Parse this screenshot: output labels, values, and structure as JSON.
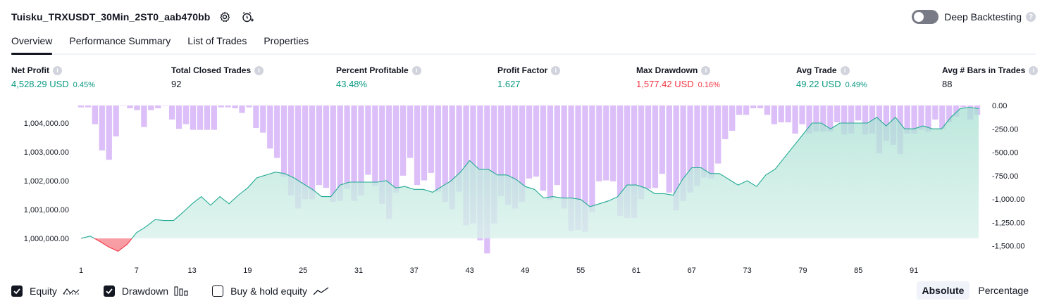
{
  "header": {
    "strategy_title": "Tuisku_TRXUSDT_30Min_2ST0_aab470bb",
    "settings_icon": "gear-icon",
    "alert_icon": "alarm-clock-plus-icon",
    "deep_backtesting_label": "Deep Backtesting",
    "deep_backtesting_enabled": false,
    "help": "?"
  },
  "tabs": [
    {
      "label": "Overview",
      "active": true
    },
    {
      "label": "Performance Summary",
      "active": false
    },
    {
      "label": "List of Trades",
      "active": false
    },
    {
      "label": "Properties",
      "active": false
    }
  ],
  "metrics": [
    {
      "label": "Net Profit",
      "value": "4,528.29 USD",
      "pct": "0.45%",
      "color": "pos"
    },
    {
      "label": "Total Closed Trades",
      "value": "92",
      "pct": "",
      "color": "neutral"
    },
    {
      "label": "Percent Profitable",
      "value": "43.48%",
      "pct": "",
      "color": "pos"
    },
    {
      "label": "Profit Factor",
      "value": "1.627",
      "pct": "",
      "color": "pos"
    },
    {
      "label": "Max Drawdown",
      "value": "1,577.42 USD",
      "pct": "0.16%",
      "color": "neg"
    },
    {
      "label": "Avg Trade",
      "value": "49.22 USD",
      "pct": "0.49%",
      "color": "pos"
    },
    {
      "label": "Avg # Bars in Trades",
      "value": "88",
      "pct": "",
      "color": "neutral"
    }
  ],
  "chart_data": {
    "type": "area",
    "equity_y_ticks": [
      "1,000,000.00",
      "1,001,000.00",
      "1,002,000.00",
      "1,003,000.00",
      "1,004,000.00"
    ],
    "drawdown_y_ticks": [
      "0.00",
      "-250.00",
      "-500.00",
      "-750.00",
      "-1,000.00",
      "-1,250.00",
      "-1,500.00"
    ],
    "x_ticks": [
      "1",
      "7",
      "13",
      "19",
      "25",
      "31",
      "37",
      "43",
      "49",
      "55",
      "61",
      "67",
      "73",
      "79",
      "85",
      "91"
    ],
    "equity_baseline": 1000000,
    "equity_ylim": [
      999550,
      1004900
    ],
    "drawdown_ylim": [
      -1577,
      0
    ],
    "series": [
      {
        "name": "Equity",
        "type": "area",
        "values": [
          1000000,
          1000080,
          999900,
          999700,
          999550,
          999800,
          1000200,
          1000400,
          1000650,
          1000620,
          1000620,
          1000900,
          1001200,
          1001450,
          1001150,
          1001450,
          1001200,
          1001500,
          1001750,
          1002100,
          1002200,
          1002300,
          1002250,
          1002100,
          1001900,
          1001700,
          1001450,
          1001450,
          1001850,
          1001950,
          1001950,
          1001950,
          1001950,
          1002000,
          1001750,
          1001800,
          1001700,
          1001700,
          1001600,
          1001800,
          1002000,
          1002300,
          1002700,
          1002400,
          1002400,
          1002200,
          1002200,
          1002050,
          1001800,
          1001700,
          1001400,
          1001450,
          1001400,
          1001400,
          1001350,
          1001100,
          1001200,
          1001300,
          1001450,
          1001850,
          1001850,
          1001750,
          1001550,
          1001550,
          1001500,
          1002050,
          1002450,
          1002450,
          1002250,
          1002250,
          1002050,
          1001850,
          1002000,
          1001800,
          1002200,
          1002400,
          1002800,
          1003200,
          1003600,
          1004000,
          1004000,
          1003800,
          1004000,
          1004000,
          1004000,
          1004000,
          1004200,
          1003900,
          1004200,
          1003800,
          1003800,
          1003900,
          1003800,
          1003800,
          1004200,
          1004500,
          1004550,
          1004500
        ]
      },
      {
        "name": "Drawdown",
        "type": "bar",
        "values": [
          -20,
          -20,
          -200,
          -480,
          -580,
          -330,
          0,
          -30,
          -50,
          -230,
          -50,
          -30,
          0,
          -150,
          -250,
          -200,
          -260,
          -260,
          -260,
          -260,
          -20,
          -20,
          -30,
          -80,
          -20,
          -240,
          -290,
          -460,
          -560,
          -760,
          -960,
          -1100,
          -1000,
          -1000,
          -850,
          -880,
          -1030,
          -1020,
          -890,
          -1020,
          -960,
          -740,
          -860,
          -1050,
          -1210,
          -930,
          -750,
          -560,
          -850,
          -800,
          -720,
          -920,
          -1030,
          -1110,
          -920,
          -1280,
          -1260,
          -1440,
          -1580,
          -1260,
          -970,
          -1060,
          -1100,
          -1030,
          -780,
          -760,
          -910,
          -1010,
          -850,
          -1100,
          -1340,
          -1330,
          -1350,
          -1140,
          -810,
          -800,
          -810,
          -1180,
          -1200,
          -1200,
          -1000,
          -890,
          -880,
          -730,
          -930,
          -1120,
          -1020,
          -930,
          -860,
          -770,
          -780,
          -620,
          -360,
          -270,
          -100,
          -100,
          -30,
          -30,
          -100,
          -200,
          -180,
          -180,
          -300,
          -200,
          -300,
          -280,
          -280,
          -280,
          -180,
          -310,
          -300,
          -160,
          -310,
          -300,
          -510,
          -380,
          -420,
          -520,
          -300,
          -300,
          -260,
          -280,
          -150,
          -250,
          -180,
          -120,
          -20,
          -150,
          -100
        ]
      }
    ]
  },
  "legend": [
    {
      "label": "Equity",
      "checked": true,
      "icon": "equity-line-icon"
    },
    {
      "label": "Drawdown",
      "checked": true,
      "icon": "drawdown-bars-icon"
    },
    {
      "label": "Buy & hold equity",
      "checked": false,
      "icon": "buy-hold-line-icon"
    }
  ],
  "view_mode": {
    "options": [
      "Absolute",
      "Percentage"
    ],
    "active": "Absolute"
  },
  "colors": {
    "equity_line": "#22ab94",
    "equity_fill": "#c8ebe2",
    "equity_loss": "#f23645",
    "drawdown_bar": "#d8b8f7",
    "positive": "#089981",
    "negative": "#f23645"
  }
}
